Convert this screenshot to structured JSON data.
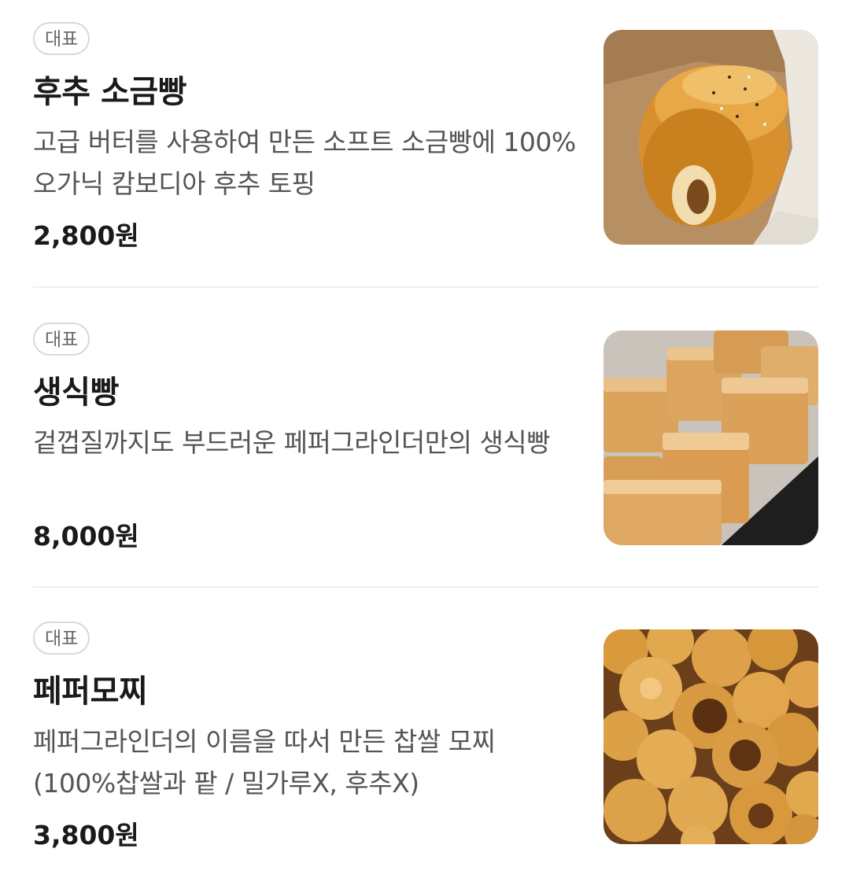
{
  "menu": {
    "items": [
      {
        "badge": "대표",
        "name": "후추 소금빵",
        "description": "고급 버터를 사용하여 만든 소프트 소금빵에 100% 오가닉 캄보디아 후추 토핑",
        "price": "2,800원"
      },
      {
        "badge": "대표",
        "name": "생식빵",
        "description": "겉껍질까지도 부드러운 페퍼그라인더만의 생식빵",
        "price": "8,000원"
      },
      {
        "badge": "대표",
        "name": "페퍼모찌",
        "description": "페퍼그라인더의 이름을 따서 만든 찹쌀 모찌 (100%찹쌀과 팥 / 밀가루X, 후추X)",
        "price": "3,800원"
      }
    ]
  },
  "colors": {
    "text_primary": "#1a1a1a",
    "text_secondary": "#555555",
    "badge_border": "#d9d9d9",
    "divider": "#f0f0f0"
  }
}
